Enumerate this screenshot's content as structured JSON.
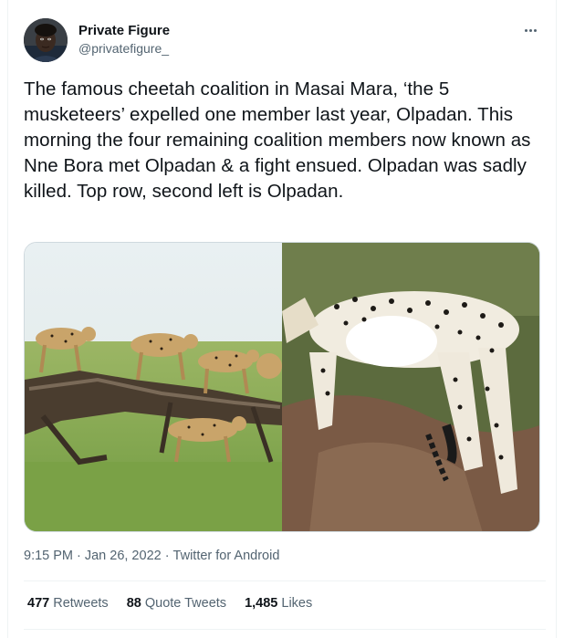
{
  "author": {
    "name": "Private Figure",
    "handle": "@privatefigure_"
  },
  "tweet": {
    "text": "The famous cheetah coalition in Masai Mara, ‘the 5 musketeers’ expelled one member last year, Olpadan. This morning the four remaining coalition members now known as Nne Bora met Olpadan & a fight ensued. Olpadan was sadly killed. Top row, second left is Olpadan."
  },
  "meta": {
    "time": "9:15 PM",
    "sep1": "·",
    "date": "Jan 26, 2022",
    "sep2": "·",
    "source": "Twitter for Android"
  },
  "stats": {
    "retweets_count": "477",
    "retweets_label": "Retweets",
    "quotes_count": "88",
    "quotes_label": "Quote Tweets",
    "likes_count": "1,485",
    "likes_label": "Likes"
  },
  "icons": {
    "more": "more-horizontal-icon"
  },
  "colors": {
    "text_primary": "#0f1419",
    "text_secondary": "#536471",
    "border": "#eff3f4"
  }
}
